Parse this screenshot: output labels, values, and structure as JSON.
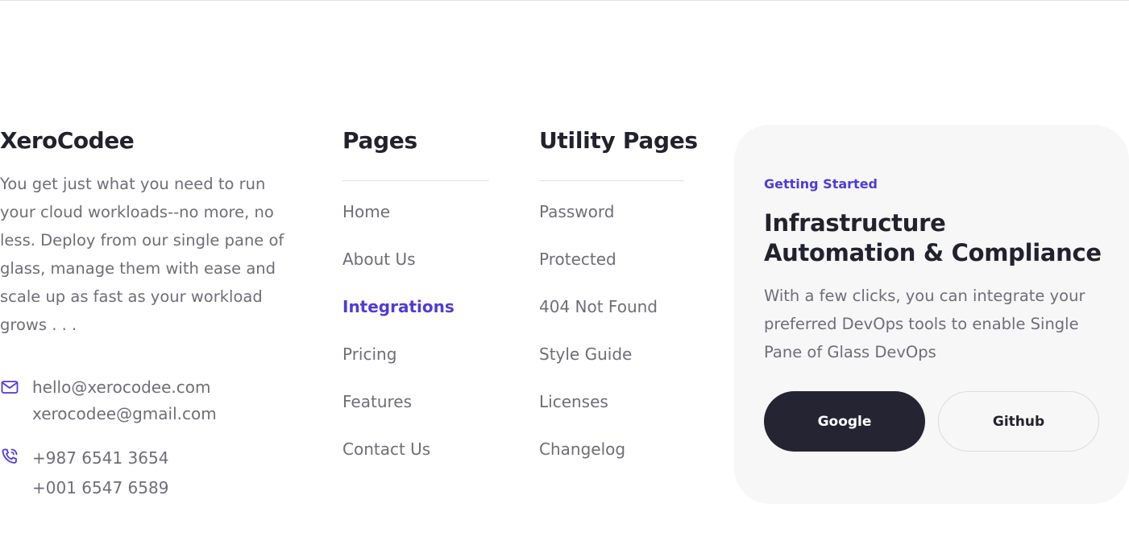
{
  "brand": {
    "name": "XeroCodee",
    "description": "You get just what you need to run your cloud workloads--no more, no less. Deploy from our single pane of glass, manage them with ease and scale up as fast as your workload grows . . ."
  },
  "contact": {
    "emails": [
      "hello@xerocodee.com",
      "xerocodee@gmail.com"
    ],
    "phones": [
      "+987 6541 3654",
      "+001 6547 6589"
    ]
  },
  "pages": {
    "title": "Pages",
    "links": [
      "Home",
      "About Us",
      "Integrations",
      "Pricing",
      "Features",
      "Contact Us"
    ],
    "active": "Integrations"
  },
  "utility": {
    "title": "Utility Pages",
    "links": [
      "Password",
      "Protected",
      "404 Not Found",
      "Style Guide",
      "Licenses",
      "Changelog"
    ]
  },
  "card": {
    "eyebrow": "Getting Started",
    "title": "Infrastructure Automation & Compliance",
    "description": "With a few clicks, you can integrate your preferred DevOps tools to enable Single Pane of Glass DevOps",
    "google_label": "Google",
    "github_label": "Github"
  },
  "colors": {
    "accent": "#4f3bdb",
    "dark": "#22222f",
    "muted": "#6e6e78",
    "card_bg": "#f7f7f8"
  },
  "icons": {
    "email": "mail-icon",
    "phone": "phone-icon"
  }
}
